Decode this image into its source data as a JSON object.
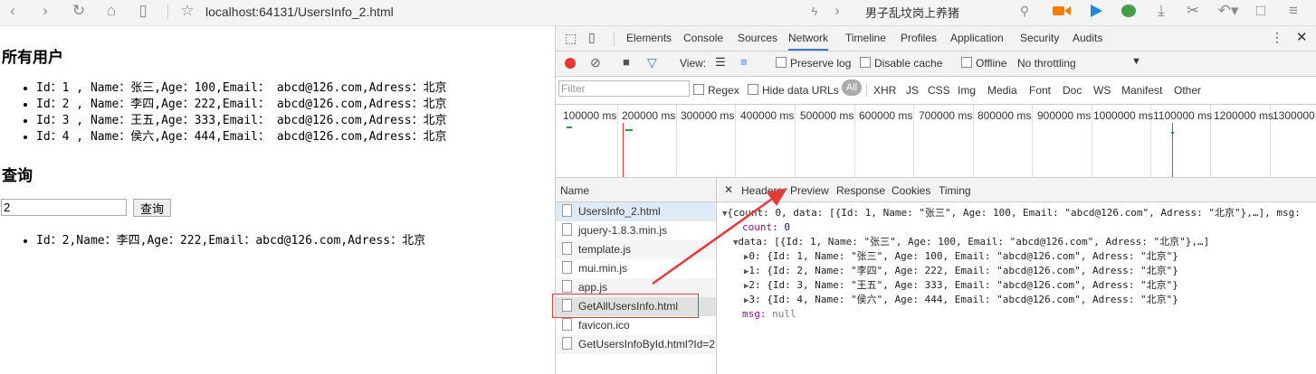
{
  "browser": {
    "url": "localhost:64131/UsersInfo_2.html",
    "search_text": "男子乱坟岗上养猪"
  },
  "page": {
    "all_users_heading": "所有用户",
    "all_users": [
      "Id：1 , Name：张三,Age：100,Email： abcd@126.com,Adress：北京",
      "Id：2 , Name：李四,Age：222,Email： abcd@126.com,Adress：北京",
      "Id：3 , Name：王五,Age：333,Email： abcd@126.com,Adress：北京",
      "Id：4 , Name：侯六,Age：444,Email： abcd@126.com,Adress：北京"
    ],
    "query_heading": "查询",
    "query_value": "2",
    "query_button": "查询",
    "query_result": "Id：2,Name：李四,Age：222,Email：abcd@126.com,Adress：北京"
  },
  "devtools": {
    "main_tabs": [
      "Elements",
      "Console",
      "Sources",
      "Network",
      "Timeline",
      "Profiles",
      "Application",
      "Security",
      "Audits"
    ],
    "active_tab": "Network",
    "toolbar": {
      "view_label": "View:",
      "preserve_log": "Preserve log",
      "disable_cache": "Disable cache",
      "offline": "Offline",
      "throttling": "No throttling"
    },
    "filter": {
      "placeholder": "Filter",
      "regex": "Regex",
      "hide_data_urls": "Hide data URLs",
      "all": "All",
      "types": [
        "XHR",
        "JS",
        "CSS",
        "Img",
        "Media",
        "Font",
        "Doc",
        "WS",
        "Manifest",
        "Other"
      ]
    },
    "timeline_ticks": [
      "100000 ms",
      "200000 ms",
      "300000 ms",
      "400000 ms",
      "500000 ms",
      "600000 ms",
      "700000 ms",
      "800000 ms",
      "900000 ms",
      "1000000 ms",
      "1100000 ms",
      "1200000 ms",
      "1300000"
    ],
    "name_header": "Name",
    "files": [
      "UsersInfo_2.html",
      "jquery-1.8.3.min.js",
      "template.js",
      "mui.min.js",
      "app.js",
      "GetAllUsersInfo.html",
      "favicon.ico",
      "GetUsersInfoById.html?Id=2"
    ],
    "selected_file": "GetAllUsersInfo.html",
    "detail_tabs": [
      "Headers",
      "Preview",
      "Response",
      "Cookies",
      "Timing"
    ],
    "active_detail_tab": "Preview",
    "preview": {
      "summary": "{count: 0, data: [{Id: 1, Name: \"张三\", Age: 100, Email: \"abcd@126.com\", Adress: \"北京\"},…], msg:",
      "count_key": "count:",
      "count_val": "0",
      "data_line": "data: [{Id: 1, Name: \"张三\", Age: 100, Email: \"abcd@126.com\", Adress: \"北京\"},…]",
      "rows": [
        "0: {Id: 1, Name: \"张三\", Age: 100, Email: \"abcd@126.com\", Adress: \"北京\"}",
        "1: {Id: 2, Name: \"李四\", Age: 222, Email: \"abcd@126.com\", Adress: \"北京\"}",
        "2: {Id: 3, Name: \"王五\", Age: 333, Email: \"abcd@126.com\", Adress: \"北京\"}",
        "3: {Id: 4, Name: \"侯六\", Age: 444, Email: \"abcd@126.com\", Adress: \"北京\"}"
      ],
      "msg_key": "msg:",
      "msg_val": "null"
    }
  },
  "colors": {
    "annotation_red": "#e53935",
    "active_tab_blue": "#3879d9",
    "record_red": "#e33"
  }
}
